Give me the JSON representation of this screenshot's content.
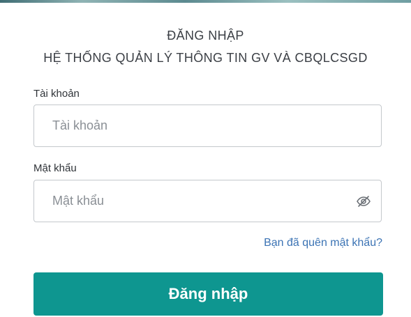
{
  "header": {
    "title": "ĐĂNG NHẬP",
    "subtitle": "HỆ THỐNG QUẢN LÝ THÔNG TIN GV VÀ CBQLCSGD"
  },
  "form": {
    "username": {
      "label": "Tài khoản",
      "placeholder": "Tài khoản",
      "value": ""
    },
    "password": {
      "label": "Mật khẩu",
      "placeholder": "Mật khẩu",
      "value": "",
      "toggle_icon": "eye-slash-icon"
    },
    "forgot_link": "Bạn đã quên mật khẩu?",
    "submit_label": "Đăng nhập"
  },
  "colors": {
    "primary_button": "#0e9690",
    "link": "#3b73b4",
    "text": "#3b3f45",
    "input_border": "#c4c8cc"
  }
}
